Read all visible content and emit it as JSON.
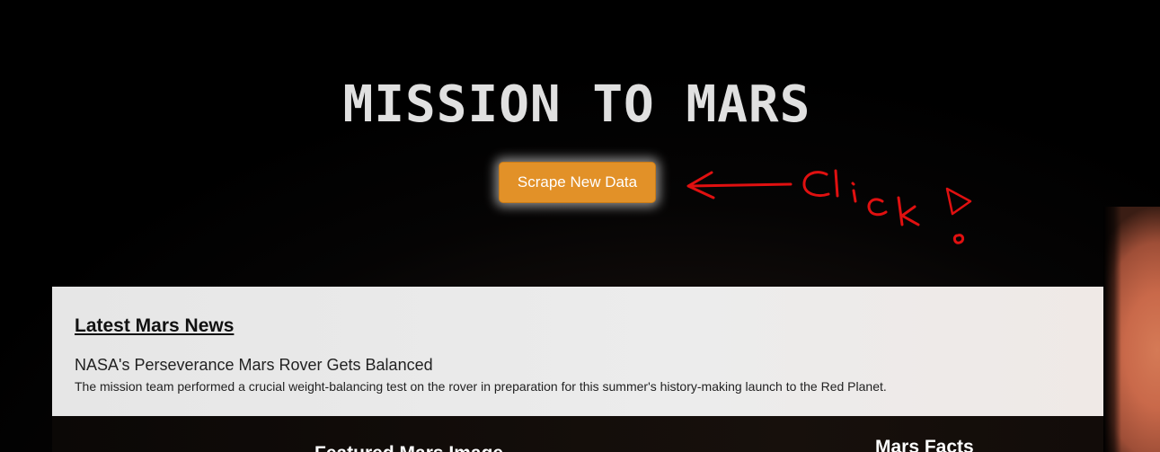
{
  "header": {
    "title": "MISSION TO MARS",
    "scrape_button_label": "Scrape New Data"
  },
  "annotation": {
    "text": "Click!",
    "color": "#e01010"
  },
  "news": {
    "heading": "Latest Mars News",
    "title": "NASA's Perseverance Mars Rover Gets Balanced",
    "paragraph": "The mission team performed a crucial weight-balancing test on the rover in preparation for this summer's history-making launch to the Red Planet."
  },
  "featured": {
    "heading": "Featured Mars Image"
  },
  "facts": {
    "heading": "Mars Facts"
  },
  "colors": {
    "button": "#e29128",
    "panel": "#e8e8e8",
    "title": "#e0e0e0"
  }
}
